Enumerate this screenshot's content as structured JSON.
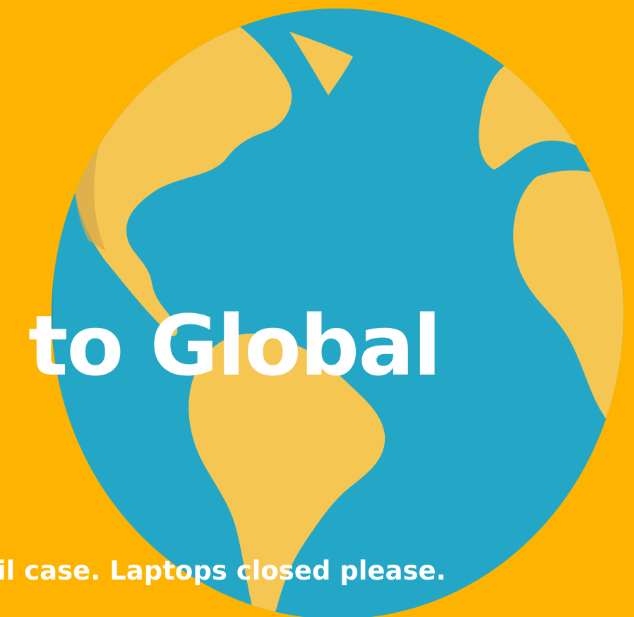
{
  "slide": {
    "title": "to Global",
    "subtitle": "il case. Laptops closed please."
  },
  "colors": {
    "background": "#FDB300",
    "ocean": "#24A7C7",
    "land": "#F6C653",
    "text": "#FFFFFF"
  },
  "illustration": {
    "icon": "globe-icon"
  }
}
